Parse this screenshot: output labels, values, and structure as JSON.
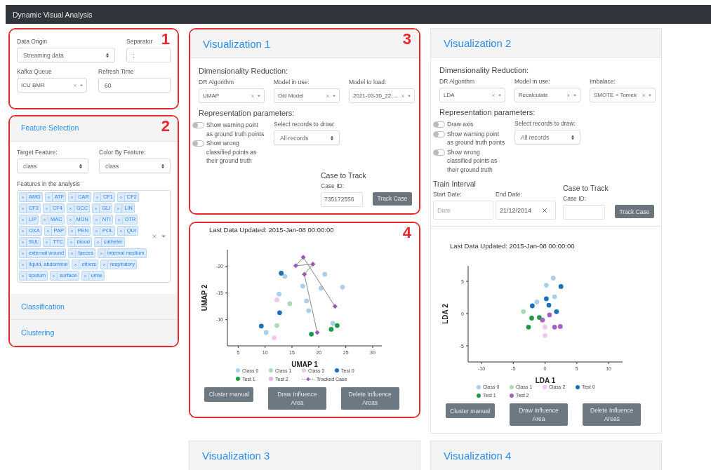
{
  "navbar": {
    "title": "Dynamic Visual Analysis"
  },
  "data_source": {
    "annotation": "1",
    "fields": [
      {
        "label": "Data Origin",
        "kind": "select",
        "value": "Streaming data"
      },
      {
        "label": "Separator",
        "kind": "input",
        "value": ";"
      },
      {
        "label": "Kafka Queue",
        "kind": "combo",
        "value": "ICU BMR"
      },
      {
        "label": "Refresh Time",
        "kind": "input",
        "value": "60"
      }
    ]
  },
  "sidebar": {
    "annotation": "2",
    "sections": [
      {
        "title": "Feature Selection",
        "expanded": true
      },
      {
        "title": "Classification",
        "expanded": false
      },
      {
        "title": "Clustering",
        "expanded": false
      }
    ],
    "feature_selection": {
      "fields": [
        {
          "label": "Target Feature:",
          "kind": "select",
          "value": "class"
        },
        {
          "label": "Color By Feature:",
          "kind": "select",
          "value": "class"
        }
      ],
      "features_label": "Features in the analysis",
      "features": [
        "AMG",
        "ATF",
        "CAR",
        "CF1",
        "CF2",
        "CF3",
        "CF4",
        "GCC",
        "GLI",
        "LIN",
        "LIP",
        "MAC",
        "MON",
        "NTI",
        "OTR",
        "OXA",
        "PAP",
        "PEN",
        "POL",
        "QUI",
        "SUL",
        "TTC",
        "blood",
        "catheter",
        "external wound",
        "faeces",
        "internal medium",
        "liquid, abdominal",
        "others",
        "respiratory",
        "sputum",
        "surface",
        "urine"
      ]
    }
  },
  "visualizations": [
    {
      "title": "Visualization 1",
      "annotation": "3",
      "dr_heading": "Dimensionality Reduction:",
      "dr_fields": [
        {
          "label": "DR Algorithm",
          "kind": "combo",
          "value": "UMAP"
        },
        {
          "label": "Model in use:",
          "kind": "combo",
          "value": "Old Model"
        },
        {
          "label": "Model to load:",
          "kind": "combo",
          "value": "2021-03-30_22:…"
        }
      ],
      "rep_heading": "Representation parameters:",
      "toggles": [
        {
          "label": "Show warning point as ground truth points",
          "on": false
        },
        {
          "label": "Show wrong classified points as their ground truth",
          "on": false
        }
      ],
      "records": {
        "label": "Select records to draw:",
        "kind": "select",
        "value": "All records"
      },
      "case": {
        "heading": "Case to Track",
        "label": "Case ID:",
        "value": "735172556",
        "button": "Track Case"
      },
      "plot": {
        "annotation": "4",
        "updated": "Last Data Updated: 2015-Jan-08 00:00:00",
        "chart_data": {
          "type": "scatter",
          "legend": "bottom",
          "xlabel": "UMAP 1",
          "ylabel": "UMAP 2",
          "xlim": [
            3,
            31.7
          ],
          "ylim": [
            -5.1,
            -23.1
          ],
          "xticks": [
            5,
            10,
            15,
            20,
            25,
            30
          ],
          "yticks": [
            -20,
            -15,
            -10
          ],
          "series": [
            {
              "name": "Class 0",
              "color": "#a9cfea",
              "x": [
                13.7,
                24.4,
                21.1,
                17.7,
                18.1,
                17,
                22.6,
                10.2,
                12.6,
                20.4
              ],
              "values": [
                -18.1,
                -16.1,
                -18.5,
                -13.5,
                -11.7,
                -16.3,
                -9.3,
                -7.6,
                -14.8,
                -15.9
              ]
            },
            {
              "name": "Class 1",
              "color": "#a9dcb3",
              "x": [
                14.6,
                12.2
              ],
              "values": [
                -13,
                -8.9
              ]
            },
            {
              "name": "Class 2",
              "color": "#f0c8ec",
              "x": [
                12.2,
                11.7
              ],
              "values": [
                -13.7,
                -6.6
              ]
            },
            {
              "name": "Test 0",
              "color": "#1c6fb8",
              "x": [
                13,
                12.7,
                9.3
              ],
              "values": [
                -18.7,
                -11.3,
                -8.8
              ]
            },
            {
              "name": "Test 1",
              "color": "#1f9a44",
              "x": [
                18.6,
                23.4,
                22.3
              ],
              "values": [
                -7.3,
                -8.9,
                -8.2
              ]
            },
            {
              "name": "Test 2",
              "color": "#e6b3e6"
            },
            {
              "name": "Tracked Case",
              "color": "#9b59b6",
              "type": "line",
              "marker": "diamond",
              "x": [
                23,
                17.1,
                15.7,
                18.9,
                17.3,
                19.7
              ],
              "values": [
                -12.5,
                -21.7,
                -20.1,
                -20.4,
                -18.5,
                -7.6
              ]
            }
          ]
        },
        "buttons": [
          "Cluster manual",
          "Draw Influence Area",
          "Delete Influence Areas"
        ]
      }
    },
    {
      "title": "Visualization 2",
      "dr_heading": "Dimensionality Reduction:",
      "dr_fields": [
        {
          "label": "DR Algorithm",
          "kind": "combo",
          "value": "LDA"
        },
        {
          "label": "Model in use:",
          "kind": "combo",
          "value": "Recalculate"
        },
        {
          "label": "Imbalace:",
          "kind": "combo",
          "value": "SMOTE + Tomek"
        }
      ],
      "rep_heading": "Representation parameters:",
      "toggles": [
        {
          "label": "Draw axis",
          "on": false
        },
        {
          "label": "Show warning point as ground truth points",
          "on": false
        },
        {
          "label": "Show wrong classified points as their ground truth",
          "on": false
        }
      ],
      "records": {
        "label": "Select records to draw:",
        "kind": "select",
        "value": "All records"
      },
      "train_interval": {
        "heading": "Train Interval",
        "start": {
          "label": "Start Date:",
          "placeholder": "Date"
        },
        "end": {
          "label": "End Date:",
          "value": "21/12/2014"
        }
      },
      "case": {
        "heading": "Case to Track",
        "label": "Case ID:",
        "button": "Track Case"
      },
      "plot": {
        "updated": "Last Data Updated: 2015-Jan-08 00:00:00",
        "chart_data": {
          "type": "scatter",
          "legend": "bottom",
          "xlabel": "LDA 1",
          "ylabel": "LDA 2",
          "xlim": [
            -12.1,
            12.2
          ],
          "ylim": [
            -7.5,
            7.4
          ],
          "xticks": [
            -10,
            -5,
            0,
            5,
            10
          ],
          "yticks": [
            -5,
            0,
            5
          ],
          "series": [
            {
              "name": "Class 0",
              "color": "#a9cfea",
              "x": [
                1.3,
                0.2,
                1.5,
                -1.3
              ],
              "values": [
                5.5,
                4.4,
                2.6,
                1.8
              ]
            },
            {
              "name": "Class 1",
              "color": "#a9dcb3",
              "x": [
                -3.4
              ],
              "values": [
                0.3
              ]
            },
            {
              "name": "Class 2",
              "color": "#f0c8ec",
              "x": [
                0,
                0
              ],
              "values": [
                -3.4,
                -2.1
              ]
            },
            {
              "name": "Test 0",
              "color": "#1c6fb8",
              "x": [
                2.5,
                0.2,
                0.6,
                -2,
                1.8
              ],
              "values": [
                4.2,
                2.3,
                1.3,
                1.2,
                0.3
              ]
            },
            {
              "name": "Test 1",
              "color": "#1f9a44",
              "x": [
                -2.6,
                -2.1,
                -0.9
              ],
              "values": [
                -2.1,
                -0.7,
                -0.6
              ]
            },
            {
              "name": "Test 2",
              "color": "#a463c4",
              "x": [
                1.5,
                2.4,
                -0.4,
                0.7
              ],
              "values": [
                -2.1,
                -2,
                -1,
                -0.2
              ]
            }
          ]
        },
        "buttons": [
          "Cluster manual",
          "Draw Influence Area",
          "Delete Influence Areas"
        ]
      }
    },
    {
      "title": "Visualization 3"
    },
    {
      "title": "Visualization 4"
    }
  ]
}
